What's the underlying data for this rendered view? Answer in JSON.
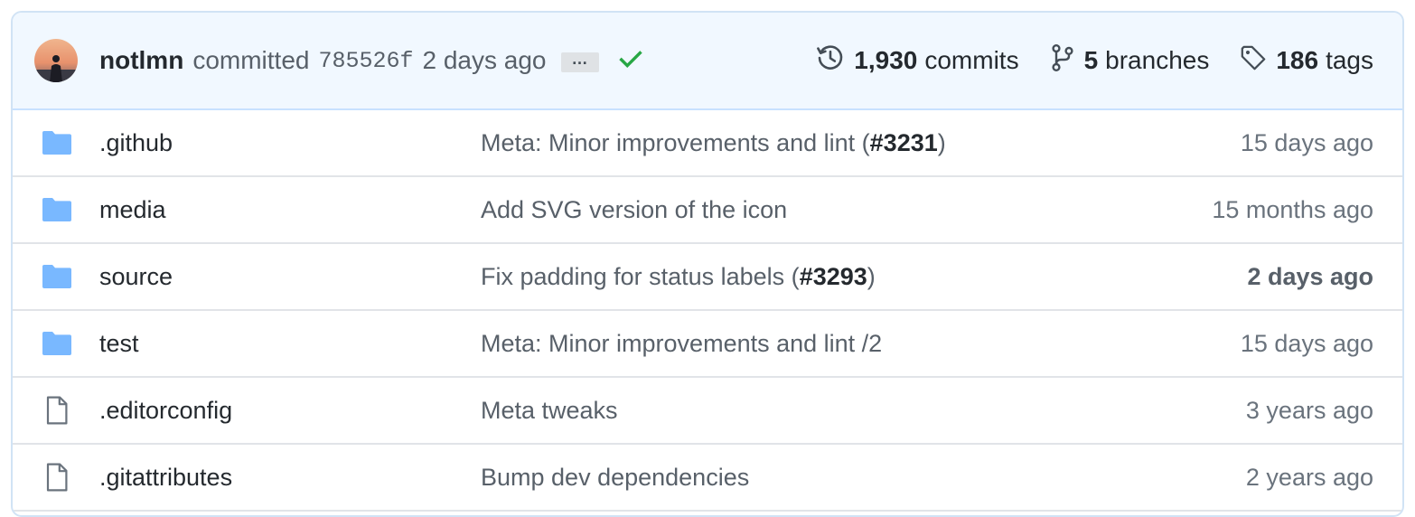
{
  "commit": {
    "author": "notlmn",
    "action": "committed",
    "sha": "785526f",
    "time": "2 days ago",
    "ellipsis": "…"
  },
  "stats": {
    "commits_count": "1,930",
    "commits_label": "commits",
    "branches_count": "5",
    "branches_label": "branches",
    "tags_count": "186",
    "tags_label": "tags"
  },
  "files": [
    {
      "type": "folder",
      "name": ".github",
      "message": "Meta: Minor improvements and lint (",
      "pr": "#3231",
      "message_end": ")",
      "age": "15 days ago",
      "age_bold": false
    },
    {
      "type": "folder",
      "name": "media",
      "message": "Add SVG version of the icon",
      "pr": "",
      "message_end": "",
      "age": "15 months ago",
      "age_bold": false
    },
    {
      "type": "folder",
      "name": "source",
      "message": "Fix padding for status labels (",
      "pr": "#3293",
      "message_end": ")",
      "age": "2 days ago",
      "age_bold": true
    },
    {
      "type": "folder",
      "name": "test",
      "message": "Meta: Minor improvements and lint /2",
      "pr": "",
      "message_end": "",
      "age": "15 days ago",
      "age_bold": false
    },
    {
      "type": "file",
      "name": ".editorconfig",
      "message": "Meta tweaks",
      "pr": "",
      "message_end": "",
      "age": "3 years ago",
      "age_bold": false
    },
    {
      "type": "file",
      "name": ".gitattributes",
      "message": "Bump dev dependencies",
      "pr": "",
      "message_end": "",
      "age": "2 years ago",
      "age_bold": false
    }
  ],
  "colors": {
    "folder": "#79b8ff",
    "check": "#28a745",
    "header_bg": "#f1f8ff"
  }
}
